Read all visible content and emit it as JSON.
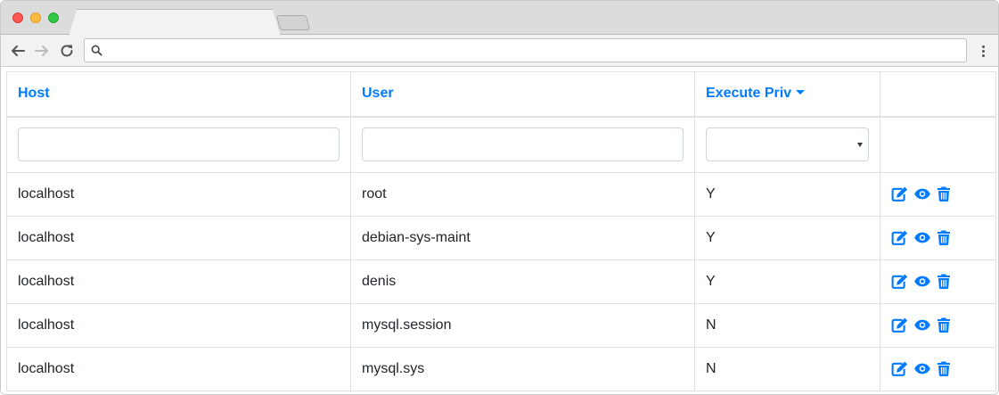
{
  "browser": {
    "active_tab_title": "",
    "address_value": "",
    "address_placeholder": ""
  },
  "table": {
    "columns": [
      {
        "label": "Host"
      },
      {
        "label": "User"
      },
      {
        "label": "Execute Priv",
        "sort_indicator": "caret-down-icon"
      },
      {
        "label": ""
      }
    ],
    "filters": {
      "host_value": "",
      "user_value": "",
      "execute_priv_selected": ""
    },
    "row_action_icons": [
      "edit-icon",
      "view-icon",
      "delete-icon"
    ],
    "rows": [
      {
        "host": "localhost",
        "user": "root",
        "execute_priv": "Y"
      },
      {
        "host": "localhost",
        "user": "debian-sys-maint",
        "execute_priv": "Y"
      },
      {
        "host": "localhost",
        "user": "denis",
        "execute_priv": "Y"
      },
      {
        "host": "localhost",
        "user": "mysql.session",
        "execute_priv": "N"
      },
      {
        "host": "localhost",
        "user": "mysql.sys",
        "execute_priv": "N"
      }
    ]
  },
  "colors": {
    "accent": "#007bff",
    "border": "#dee2e6",
    "text": "#212529"
  }
}
